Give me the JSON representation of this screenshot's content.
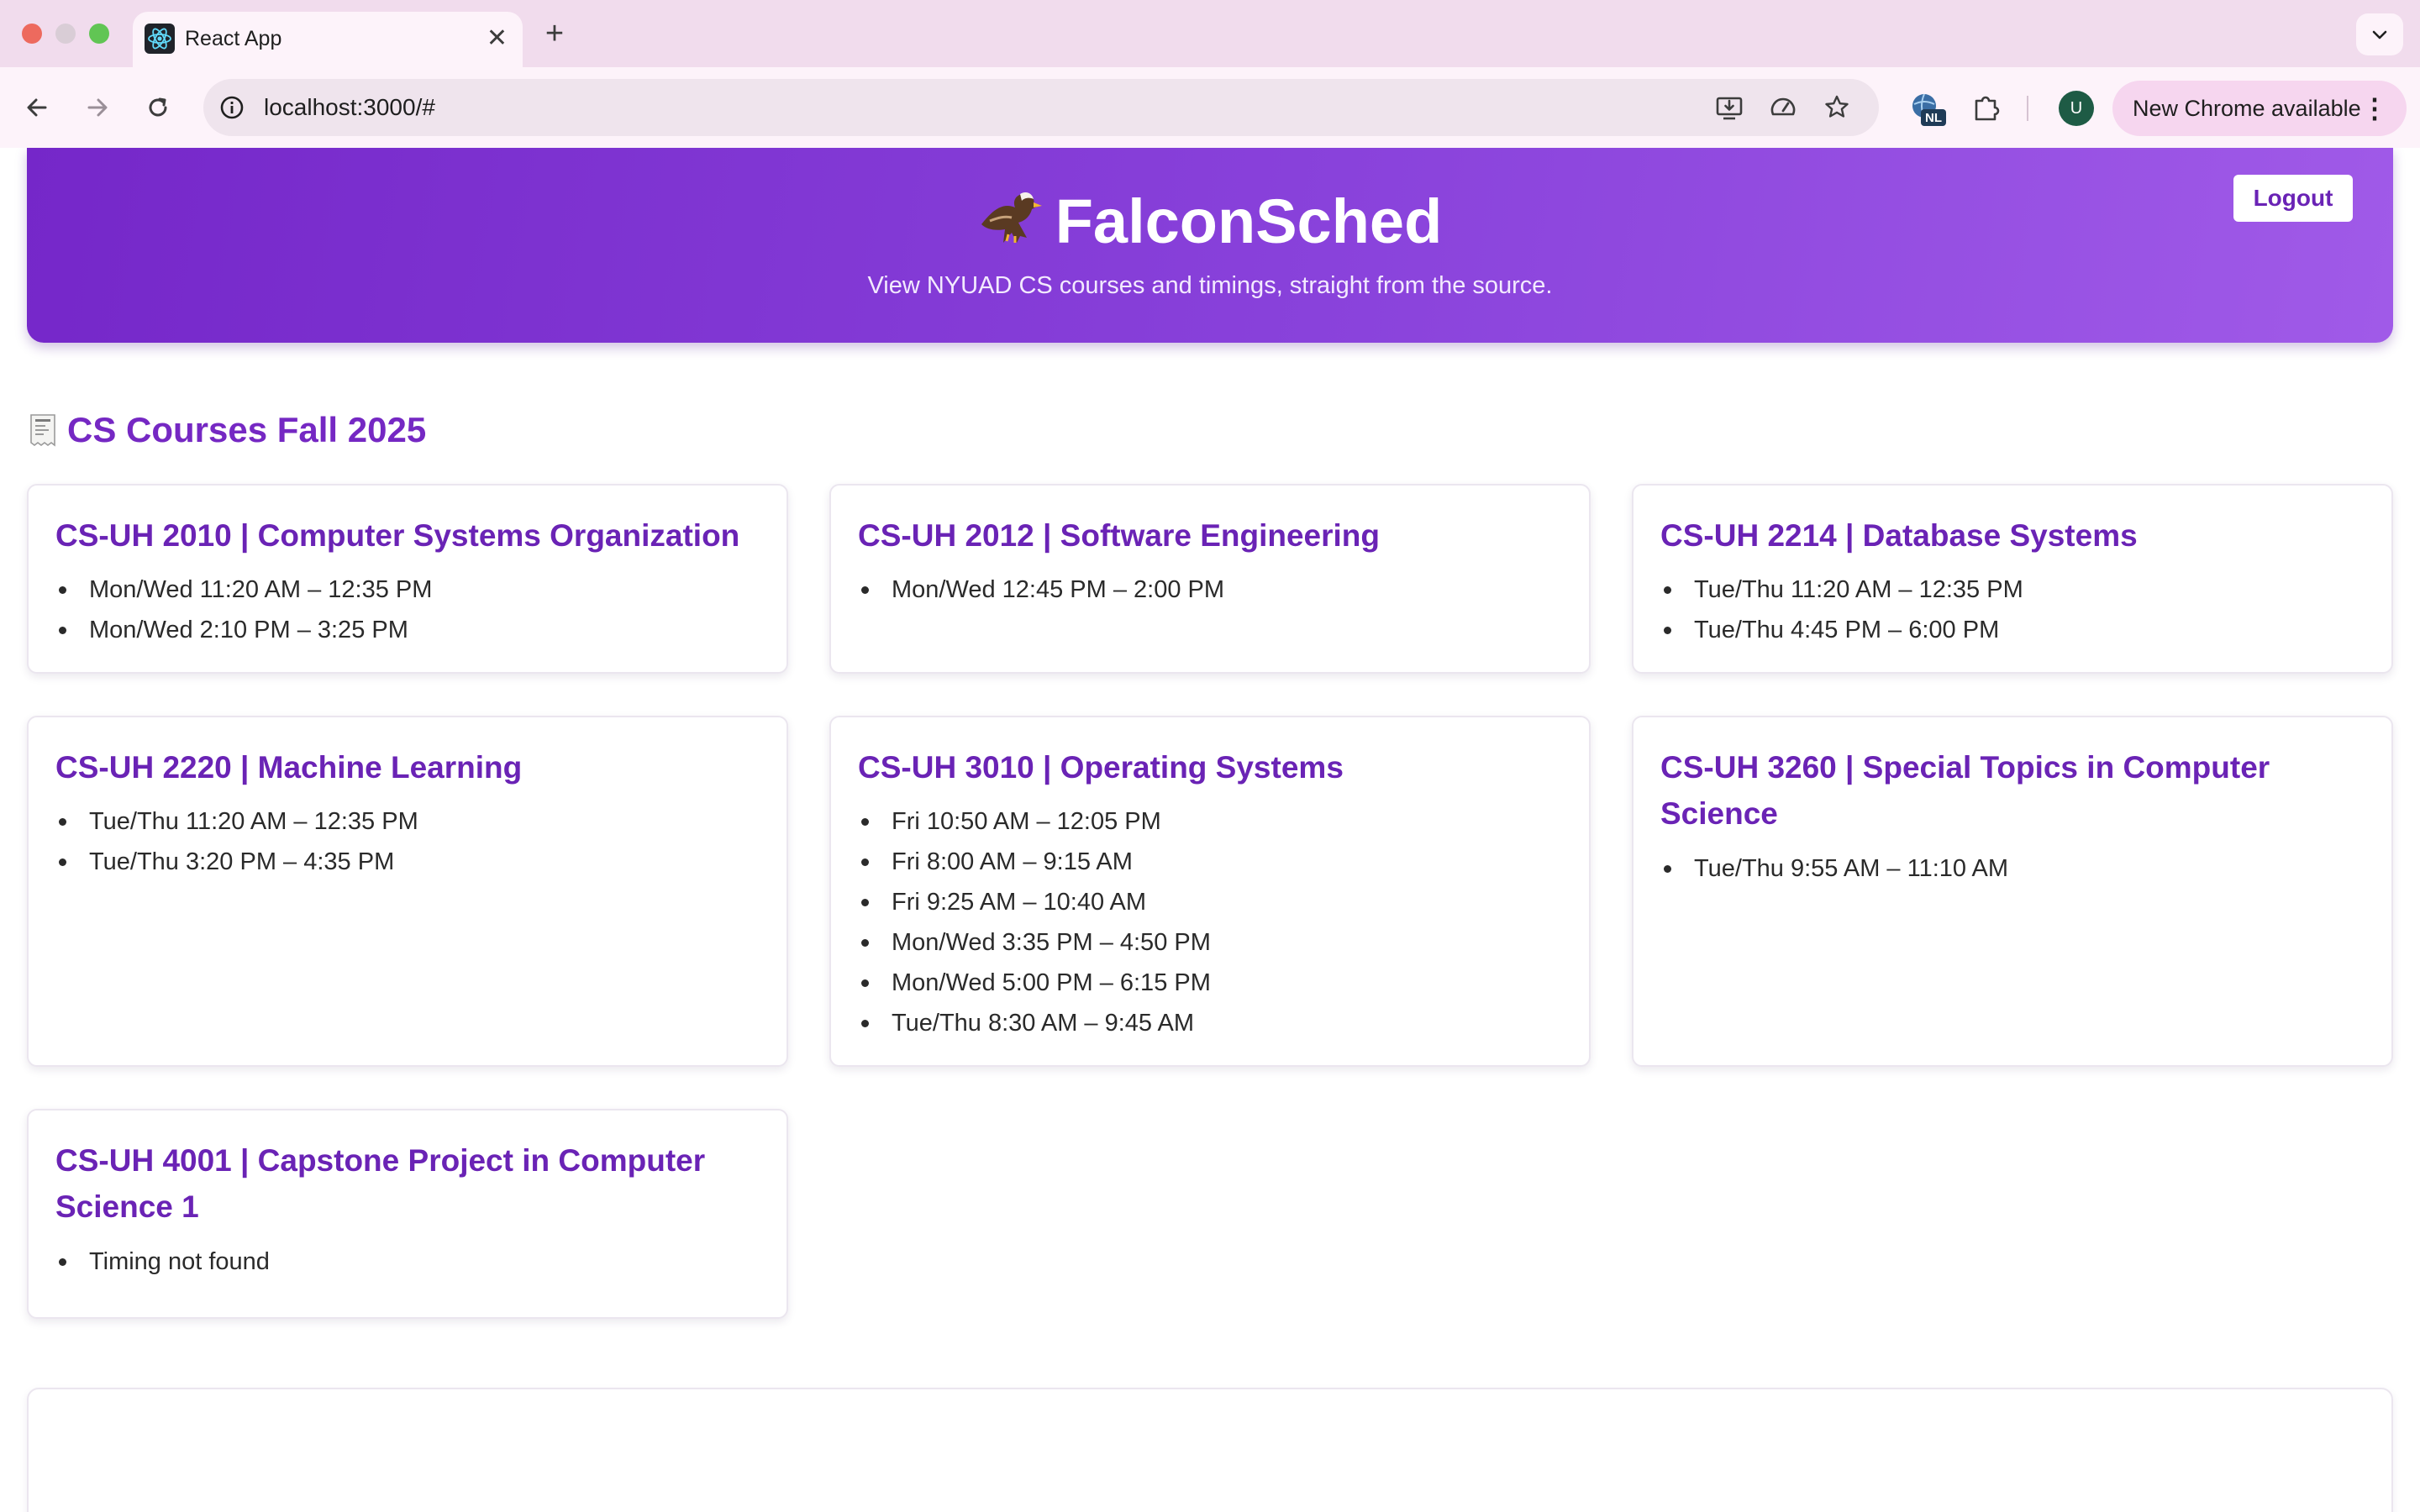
{
  "browser": {
    "tab": {
      "title": "React App",
      "favicon": "react-logo-icon",
      "close_icon": "close-icon"
    },
    "new_tab_icon": "plus-icon",
    "tab_search_icon": "chevron-down-icon",
    "nav": {
      "back_icon": "back-arrow-icon",
      "forward_icon": "forward-arrow-icon",
      "reload_icon": "reload-icon"
    },
    "omnibox": {
      "url": "localhost:3000/#",
      "site_info_icon": "info-icon",
      "icons": [
        "install-app-icon",
        "performance-icon",
        "bookmark-star-icon"
      ]
    },
    "extensions": {
      "translate_badge": "NL",
      "puzzle_icon": "extensions-puzzle-icon"
    },
    "profile_initial": "U",
    "update": {
      "label": "New Chrome available",
      "menu_icon": "more-vert-icon"
    }
  },
  "hero": {
    "title": "FalconSched",
    "emoji": "eagle-emoji",
    "subtitle": "View NYUAD CS courses and timings, straight from the source.",
    "logout_label": "Logout",
    "gradient": [
      "#7527c9",
      "#a05ae8"
    ]
  },
  "section": {
    "icon": "receipt-emoji",
    "title": "CS Courses Fall 2025",
    "color": "#7528c3"
  },
  "courses": [
    {
      "title": "CS-UH 2010 | Computer Systems Organization",
      "times": [
        "Mon/Wed 11:20 AM – 12:35 PM",
        "Mon/Wed 2:10 PM – 3:25 PM"
      ]
    },
    {
      "title": "CS-UH 2012 | Software Engineering",
      "times": [
        "Mon/Wed 12:45 PM – 2:00 PM"
      ]
    },
    {
      "title": "CS-UH 2214 | Database Systems",
      "times": [
        "Tue/Thu 11:20 AM – 12:35 PM",
        "Tue/Thu 4:45 PM – 6:00 PM"
      ]
    },
    {
      "title": "CS-UH 2220 | Machine Learning",
      "times": [
        "Tue/Thu 11:20 AM – 12:35 PM",
        "Tue/Thu 3:20 PM – 4:35 PM"
      ]
    },
    {
      "title": "CS-UH 3010 | Operating Systems",
      "times": [
        "Fri 10:50 AM – 12:05 PM",
        "Fri 8:00 AM – 9:15 AM",
        "Fri 9:25 AM – 10:40 AM",
        "Mon/Wed 3:35 PM – 4:50 PM",
        "Mon/Wed 5:00 PM – 6:15 PM",
        "Tue/Thu 8:30 AM – 9:45 AM"
      ]
    },
    {
      "title": "CS-UH 3260 | Special Topics in Computer Science",
      "times": [
        "Tue/Thu 9:55 AM – 11:10 AM"
      ]
    },
    {
      "title": "CS-UH 4001 | Capstone Project in Computer Science 1",
      "times": [
        "Timing not found"
      ]
    }
  ],
  "colors": {
    "accent": "#6a23b5",
    "card_border": "#ebe6ef"
  }
}
